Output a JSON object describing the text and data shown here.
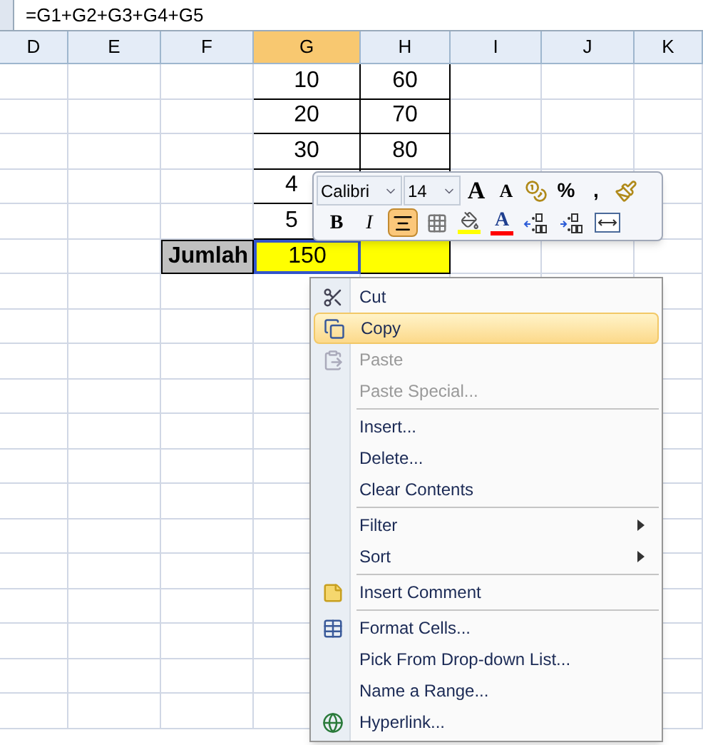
{
  "formula_bar": {
    "formula": "=G1+G2+G3+G4+G5"
  },
  "columns": [
    {
      "label": "D",
      "selected": false
    },
    {
      "label": "E",
      "selected": false
    },
    {
      "label": "F",
      "selected": false
    },
    {
      "label": "G",
      "selected": true
    },
    {
      "label": "H",
      "selected": false
    },
    {
      "label": "I",
      "selected": false
    },
    {
      "label": "J",
      "selected": false
    },
    {
      "label": "K",
      "selected": false
    }
  ],
  "rows": [
    {
      "g": {
        "value": "10"
      },
      "h": {
        "value": "60"
      }
    },
    {
      "g": {
        "value": "20"
      },
      "h": {
        "value": "70"
      }
    },
    {
      "g": {
        "value": "30"
      },
      "h": {
        "value": "80"
      }
    },
    {
      "g": {
        "value": "4",
        "kind": "partial"
      }
    },
    {
      "g": {
        "value": "5",
        "kind": "partial"
      }
    },
    {
      "f": {
        "value": "Jumlah",
        "kind": "label"
      },
      "g": {
        "value": "150",
        "kind": "total",
        "selected": true
      },
      "h": {
        "kind": "total",
        "selected": false
      }
    }
  ],
  "mini_toolbar": {
    "font": "Calibri",
    "size": "14",
    "row_1": [
      {
        "kind": "grow",
        "label": "A"
      },
      {
        "kind": "shrink",
        "label": "A"
      },
      {
        "kind": "accounting"
      },
      {
        "kind": "text",
        "label": "%"
      },
      {
        "kind": "text",
        "label": ","
      },
      {
        "kind": "painter"
      }
    ],
    "row_2": [
      {
        "kind": "bold",
        "label": "B",
        "selected": false
      },
      {
        "kind": "italic",
        "label": "I",
        "selected": false
      },
      {
        "kind": "center",
        "selected": true
      },
      {
        "kind": "borders"
      },
      {
        "kind": "fill",
        "color": "#ffff00"
      },
      {
        "kind": "font_color",
        "label": "A",
        "color": "#ff0000"
      },
      {
        "kind": "inc_decimal"
      },
      {
        "kind": "dec_decimal"
      },
      {
        "kind": "merge"
      }
    ]
  },
  "context_menu": [
    {
      "kind": "item",
      "label": "Cut",
      "disabled": false,
      "selected": false
    },
    {
      "kind": "item",
      "label": "Copy",
      "disabled": false,
      "selected": true
    },
    {
      "kind": "item",
      "label": "Paste",
      "disabled": true,
      "selected": false
    },
    {
      "kind": "item",
      "label": "Paste Special...",
      "disabled": true,
      "selected": false
    },
    {
      "kind": "separator"
    },
    {
      "kind": "item",
      "label": "Insert...",
      "disabled": false,
      "selected": false
    },
    {
      "kind": "item",
      "label": "Delete...",
      "disabled": false,
      "selected": false
    },
    {
      "kind": "item",
      "label": "Clear Contents",
      "disabled": false,
      "selected": false
    },
    {
      "kind": "separator"
    },
    {
      "kind": "item",
      "label": "Filter",
      "submenu": true,
      "disabled": false,
      "selected": false
    },
    {
      "kind": "item",
      "label": "Sort",
      "submenu": true,
      "disabled": false,
      "selected": false
    },
    {
      "kind": "separator"
    },
    {
      "kind": "item",
      "label": "Insert Comment",
      "disabled": false,
      "selected": false
    },
    {
      "kind": "separator"
    },
    {
      "kind": "item",
      "label": "Format Cells...",
      "disabled": false,
      "selected": false
    },
    {
      "kind": "item",
      "label": "Pick From Drop-down List...",
      "disabled": false,
      "selected": false
    },
    {
      "kind": "item",
      "label": "Name a Range...",
      "disabled": false,
      "selected": false
    },
    {
      "kind": "item",
      "label": "Hyperlink...",
      "disabled": false,
      "selected": false
    }
  ]
}
